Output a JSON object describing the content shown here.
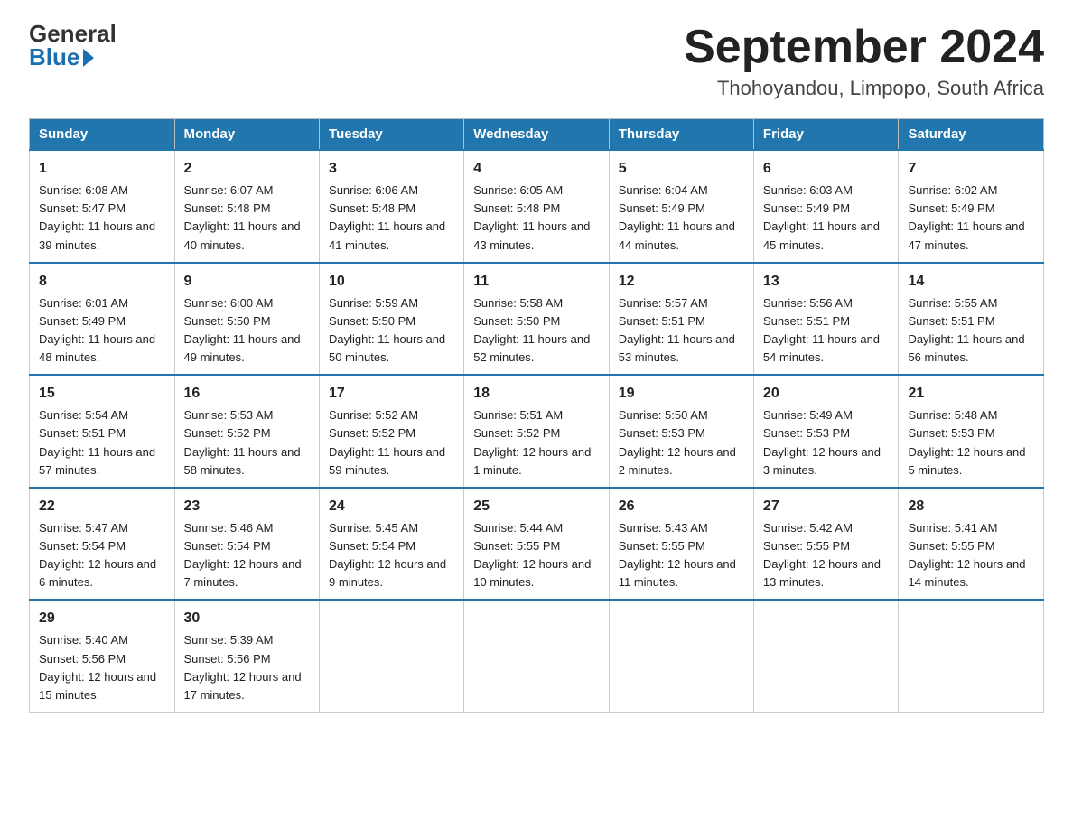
{
  "header": {
    "logo_general": "General",
    "logo_blue": "Blue",
    "month_title": "September 2024",
    "location": "Thohoyandou, Limpopo, South Africa"
  },
  "days_of_week": [
    "Sunday",
    "Monday",
    "Tuesday",
    "Wednesday",
    "Thursday",
    "Friday",
    "Saturday"
  ],
  "weeks": [
    [
      {
        "day": "1",
        "sunrise": "6:08 AM",
        "sunset": "5:47 PM",
        "daylight": "11 hours and 39 minutes."
      },
      {
        "day": "2",
        "sunrise": "6:07 AM",
        "sunset": "5:48 PM",
        "daylight": "11 hours and 40 minutes."
      },
      {
        "day": "3",
        "sunrise": "6:06 AM",
        "sunset": "5:48 PM",
        "daylight": "11 hours and 41 minutes."
      },
      {
        "day": "4",
        "sunrise": "6:05 AM",
        "sunset": "5:48 PM",
        "daylight": "11 hours and 43 minutes."
      },
      {
        "day": "5",
        "sunrise": "6:04 AM",
        "sunset": "5:49 PM",
        "daylight": "11 hours and 44 minutes."
      },
      {
        "day": "6",
        "sunrise": "6:03 AM",
        "sunset": "5:49 PM",
        "daylight": "11 hours and 45 minutes."
      },
      {
        "day": "7",
        "sunrise": "6:02 AM",
        "sunset": "5:49 PM",
        "daylight": "11 hours and 47 minutes."
      }
    ],
    [
      {
        "day": "8",
        "sunrise": "6:01 AM",
        "sunset": "5:49 PM",
        "daylight": "11 hours and 48 minutes."
      },
      {
        "day": "9",
        "sunrise": "6:00 AM",
        "sunset": "5:50 PM",
        "daylight": "11 hours and 49 minutes."
      },
      {
        "day": "10",
        "sunrise": "5:59 AM",
        "sunset": "5:50 PM",
        "daylight": "11 hours and 50 minutes."
      },
      {
        "day": "11",
        "sunrise": "5:58 AM",
        "sunset": "5:50 PM",
        "daylight": "11 hours and 52 minutes."
      },
      {
        "day": "12",
        "sunrise": "5:57 AM",
        "sunset": "5:51 PM",
        "daylight": "11 hours and 53 minutes."
      },
      {
        "day": "13",
        "sunrise": "5:56 AM",
        "sunset": "5:51 PM",
        "daylight": "11 hours and 54 minutes."
      },
      {
        "day": "14",
        "sunrise": "5:55 AM",
        "sunset": "5:51 PM",
        "daylight": "11 hours and 56 minutes."
      }
    ],
    [
      {
        "day": "15",
        "sunrise": "5:54 AM",
        "sunset": "5:51 PM",
        "daylight": "11 hours and 57 minutes."
      },
      {
        "day": "16",
        "sunrise": "5:53 AM",
        "sunset": "5:52 PM",
        "daylight": "11 hours and 58 minutes."
      },
      {
        "day": "17",
        "sunrise": "5:52 AM",
        "sunset": "5:52 PM",
        "daylight": "11 hours and 59 minutes."
      },
      {
        "day": "18",
        "sunrise": "5:51 AM",
        "sunset": "5:52 PM",
        "daylight": "12 hours and 1 minute."
      },
      {
        "day": "19",
        "sunrise": "5:50 AM",
        "sunset": "5:53 PM",
        "daylight": "12 hours and 2 minutes."
      },
      {
        "day": "20",
        "sunrise": "5:49 AM",
        "sunset": "5:53 PM",
        "daylight": "12 hours and 3 minutes."
      },
      {
        "day": "21",
        "sunrise": "5:48 AM",
        "sunset": "5:53 PM",
        "daylight": "12 hours and 5 minutes."
      }
    ],
    [
      {
        "day": "22",
        "sunrise": "5:47 AM",
        "sunset": "5:54 PM",
        "daylight": "12 hours and 6 minutes."
      },
      {
        "day": "23",
        "sunrise": "5:46 AM",
        "sunset": "5:54 PM",
        "daylight": "12 hours and 7 minutes."
      },
      {
        "day": "24",
        "sunrise": "5:45 AM",
        "sunset": "5:54 PM",
        "daylight": "12 hours and 9 minutes."
      },
      {
        "day": "25",
        "sunrise": "5:44 AM",
        "sunset": "5:55 PM",
        "daylight": "12 hours and 10 minutes."
      },
      {
        "day": "26",
        "sunrise": "5:43 AM",
        "sunset": "5:55 PM",
        "daylight": "12 hours and 11 minutes."
      },
      {
        "day": "27",
        "sunrise": "5:42 AM",
        "sunset": "5:55 PM",
        "daylight": "12 hours and 13 minutes."
      },
      {
        "day": "28",
        "sunrise": "5:41 AM",
        "sunset": "5:55 PM",
        "daylight": "12 hours and 14 minutes."
      }
    ],
    [
      {
        "day": "29",
        "sunrise": "5:40 AM",
        "sunset": "5:56 PM",
        "daylight": "12 hours and 15 minutes."
      },
      {
        "day": "30",
        "sunrise": "5:39 AM",
        "sunset": "5:56 PM",
        "daylight": "12 hours and 17 minutes."
      },
      null,
      null,
      null,
      null,
      null
    ]
  ],
  "labels": {
    "sunrise": "Sunrise: ",
    "sunset": "Sunset: ",
    "daylight": "Daylight: "
  }
}
